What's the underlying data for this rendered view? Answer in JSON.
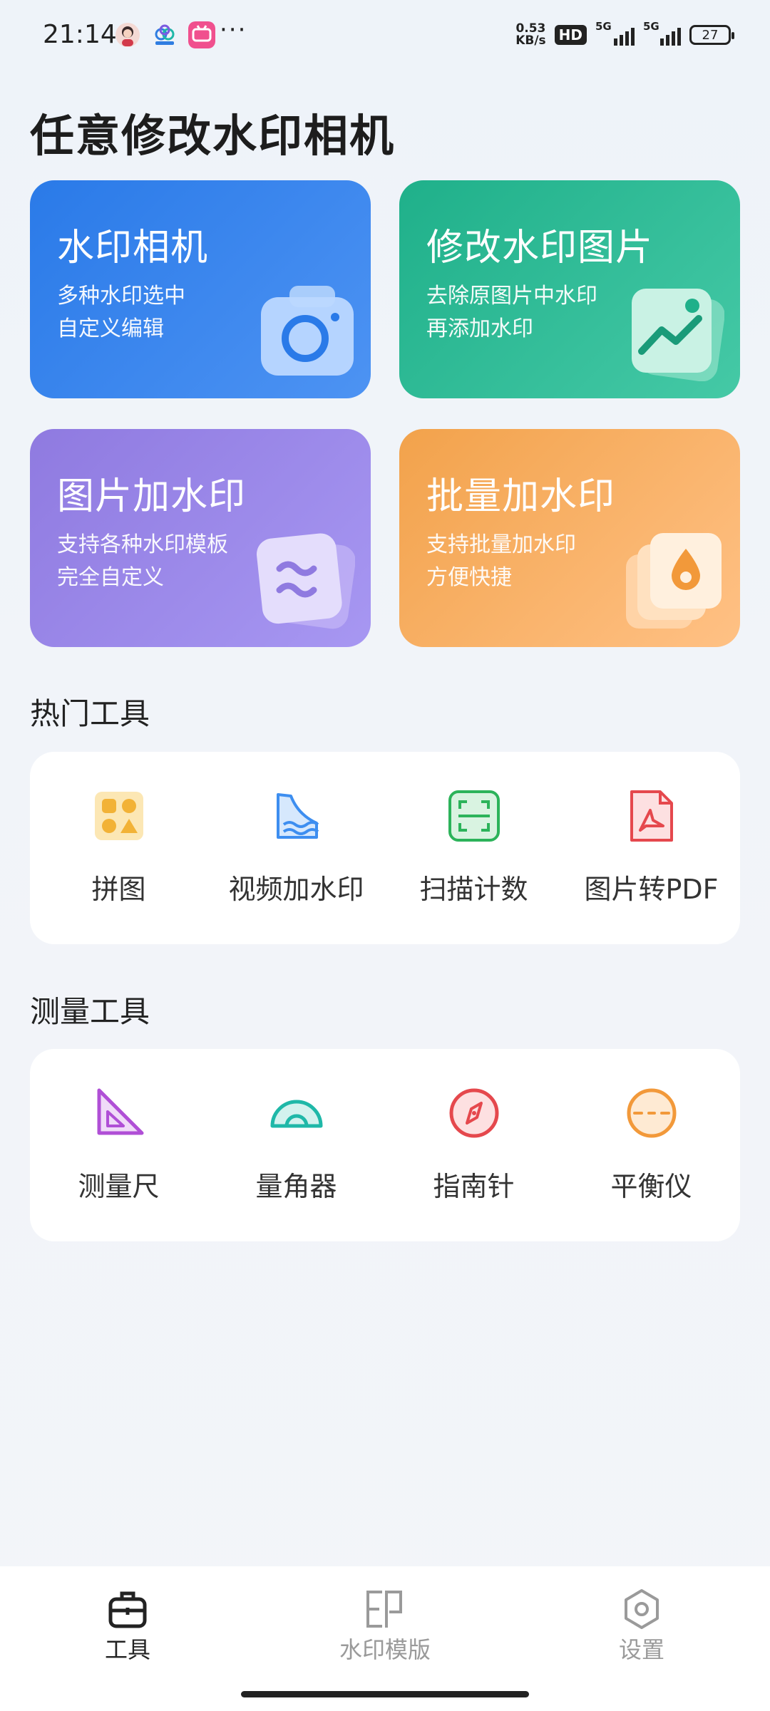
{
  "status_bar": {
    "time": "21:14",
    "more": "···",
    "net_speed_value": "0.53",
    "net_speed_unit": "KB/s",
    "hd_label": "HD",
    "signal1_label": "5G",
    "signal2_label": "5G",
    "battery": "27"
  },
  "page_title": "任意修改水印相机",
  "cards": [
    {
      "title": "水印相机",
      "desc": "多种水印选中\n自定义编辑",
      "icon": "camera-icon"
    },
    {
      "title": "修改水印图片",
      "desc": "去除原图片中水印\n再添加水印",
      "icon": "image-chart-icon"
    },
    {
      "title": "图片加水印",
      "desc": "支持各种水印模板\n完全自定义",
      "icon": "wave-layers-icon"
    },
    {
      "title": "批量加水印",
      "desc": "支持批量加水印\n方便快捷",
      "icon": "drop-stack-icon"
    }
  ],
  "hot_tools": {
    "title": "热门工具",
    "items": [
      {
        "label": "拼图",
        "icon": "collage-icon",
        "color": "#f2b236"
      },
      {
        "label": "视频加水印",
        "icon": "video-wave-icon",
        "color": "#3d8ef0"
      },
      {
        "label": "扫描计数",
        "icon": "scan-icon",
        "color": "#2cb35a"
      },
      {
        "label": "图片转PDF",
        "icon": "pdf-icon",
        "color": "#e5484d"
      }
    ]
  },
  "measure_tools": {
    "title": "测量工具",
    "items": [
      {
        "label": "测量尺",
        "icon": "set-square-icon",
        "color": "#b04fd6"
      },
      {
        "label": "量角器",
        "icon": "protractor-icon",
        "color": "#1fb8a8"
      },
      {
        "label": "指南针",
        "icon": "compass-icon",
        "color": "#e5484d"
      },
      {
        "label": "平衡仪",
        "icon": "level-icon",
        "color": "#f2993a"
      }
    ]
  },
  "tabbar": {
    "items": [
      {
        "label": "工具",
        "icon": "toolbox-icon",
        "active": true
      },
      {
        "label": "水印模版",
        "icon": "watermark-icon",
        "active": false
      },
      {
        "label": "设置",
        "icon": "settings-hex-icon",
        "active": false
      }
    ]
  }
}
